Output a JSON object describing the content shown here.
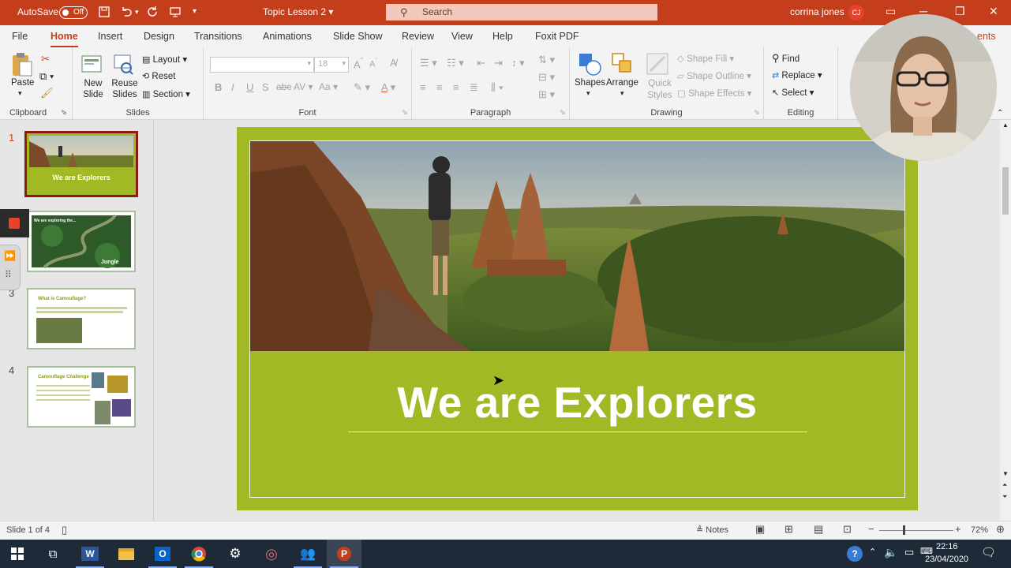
{
  "app": {
    "autosave_label": "AutoSave",
    "autosave_state": "Off",
    "doc_title": "Topic Lesson 2",
    "search_placeholder": "Search",
    "user_name": "corrina jones",
    "user_initials": "CJ"
  },
  "tabs": [
    "File",
    "Home",
    "Insert",
    "Design",
    "Transitions",
    "Animations",
    "Slide Show",
    "Review",
    "View",
    "Help",
    "Foxit PDF"
  ],
  "tabs_extra": "ents",
  "active_tab": "Home",
  "ribbon": {
    "clipboard": {
      "paste": "Paste",
      "label": "Clipboard"
    },
    "slides": {
      "new_slide": "New Slide",
      "reuse_slides": "Reuse Slides",
      "layout": "Layout",
      "reset": "Reset",
      "section": "Section",
      "label": "Slides"
    },
    "font": {
      "size": "18",
      "label": "Font"
    },
    "paragraph": {
      "label": "Paragraph"
    },
    "drawing": {
      "shapes": "Shapes",
      "arrange": "Arrange",
      "quick_styles": "Quick Styles",
      "shape_fill": "Shape Fill",
      "shape_outline": "Shape Outline",
      "shape_effects": "Shape Effects",
      "label": "Drawing"
    },
    "editing": {
      "find": "Find",
      "replace": "Replace",
      "select": "Select",
      "label": "Editing"
    }
  },
  "thumbnails": [
    {
      "num": "1",
      "title": "We are Explorers"
    },
    {
      "num": "2",
      "title": "We are exploring the...",
      "sub": "Jungle"
    },
    {
      "num": "3",
      "title": "What is Camouflage?"
    },
    {
      "num": "4",
      "title": "Camouflage Challenge"
    }
  ],
  "slide": {
    "title": "We are Explorers"
  },
  "status": {
    "slide_info": "Slide 1 of 4",
    "notes": "Notes",
    "zoom": "72%"
  },
  "taskbar": {
    "time": "22:16",
    "date": "23/04/2020"
  },
  "colors": {
    "accent": "#c43e1c",
    "slide_green": "#a2b925",
    "taskbar": "#1f2a38"
  }
}
